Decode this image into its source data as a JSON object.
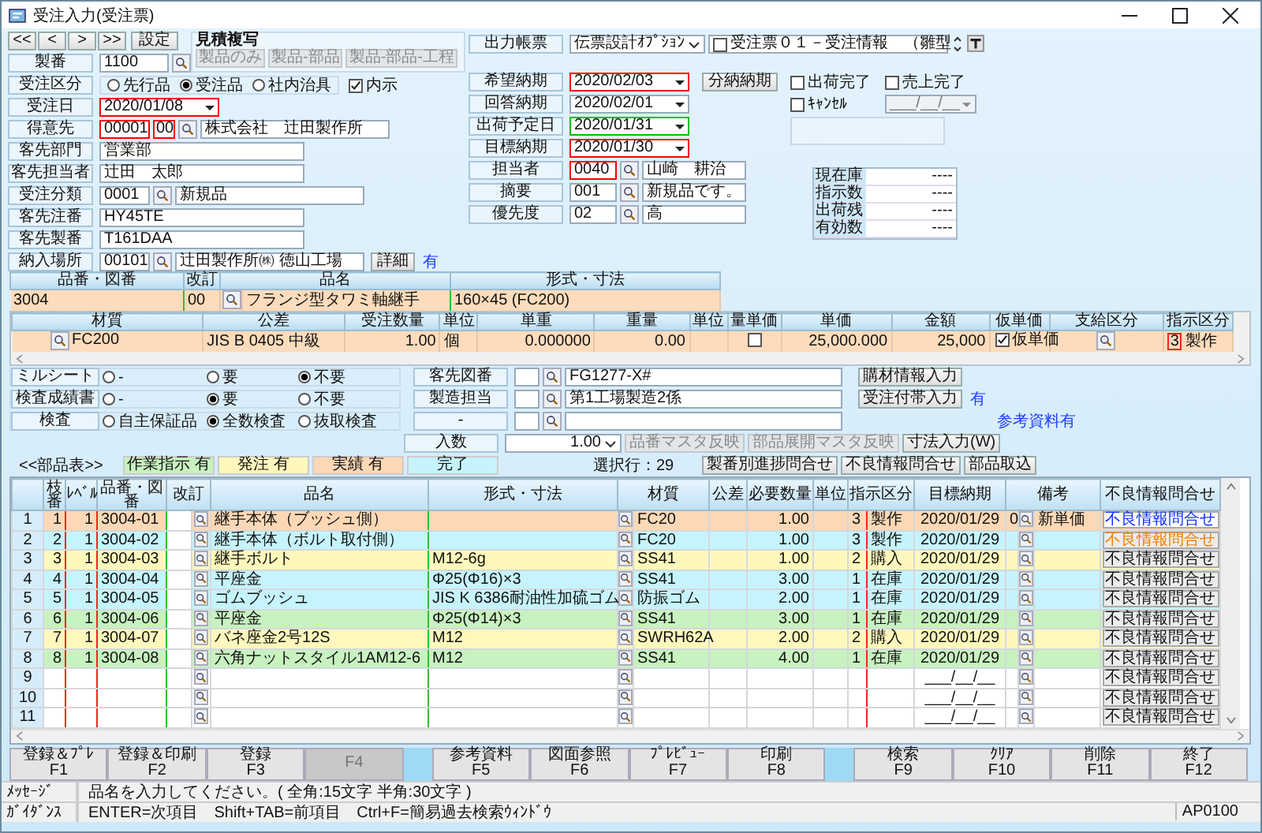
{
  "window": {
    "title": "受注入力(受注票)"
  },
  "nav_buttons": [
    "<<",
    "<",
    ">",
    ">>"
  ],
  "settings_button": "設定",
  "estimate_copy": {
    "title": "見積複写",
    "buttons": [
      {
        "label": "製品のみ",
        "disabled": true
      },
      {
        "label": "製品-部品",
        "disabled": true
      },
      {
        "label": "製品-部品-工程",
        "disabled": true
      }
    ]
  },
  "left_fields": [
    {
      "label": "製番",
      "kind": "lookup",
      "value": "1100"
    },
    {
      "label": "受注区分",
      "kind": "radio",
      "choices": [
        {
          "label": "先行品",
          "selected": false
        },
        {
          "label": "受注品",
          "selected": true
        },
        {
          "label": "社内治具",
          "selected": false
        }
      ],
      "checkbox": {
        "label": "内示",
        "checked": true
      }
    },
    {
      "label": "受注日",
      "kind": "date",
      "value": "2020/01/08",
      "color": "#ff0000"
    },
    {
      "label": "得意先",
      "kind": "code",
      "code": "00001",
      "sub_code": "00",
      "color": "#ff0000",
      "name": "株式会社　辻田製作所"
    },
    {
      "label": "客先部門",
      "kind": "text",
      "value": "営業部"
    },
    {
      "label": "客先担当者",
      "kind": "text",
      "value": "辻田　太郎"
    },
    {
      "label": "受注分類",
      "kind": "code",
      "code": "0001",
      "name": "新規品"
    },
    {
      "label": "客先注番",
      "kind": "text",
      "value": "HY45TE"
    },
    {
      "label": "客先製番",
      "kind": "text",
      "value": "T161DAA"
    },
    {
      "label": "納入場所",
      "kind": "code",
      "code": "00101",
      "name": "辻田製作所㈱ 徳山工場",
      "button": "詳細",
      "note": "有"
    }
  ],
  "output": {
    "label": "出力帳票",
    "value": "伝票設計ｵﾌﾟｼｮﾝ",
    "form": {
      "label": "受注票０１－受注情報　（雛型",
      "checked": false
    }
  },
  "mid_fields": [
    {
      "label": "希望納期",
      "kind": "date",
      "value": "2020/02/03",
      "color": "#ff0000",
      "button": "分納納期"
    },
    {
      "label": "回答納期",
      "kind": "date",
      "value": "2020/02/01"
    },
    {
      "label": "出荷予定日",
      "kind": "date",
      "value": "2020/01/31",
      "color": "#00c000"
    },
    {
      "label": "目標納期",
      "kind": "date",
      "value": "2020/01/30",
      "color": "#ff0000"
    },
    {
      "label": "担当者",
      "kind": "code",
      "code": "0040",
      "color": "#ff0000",
      "name": "山崎　耕治"
    },
    {
      "label": "摘要",
      "kind": "code",
      "code": "001",
      "name": "新規品です。"
    },
    {
      "label": "優先度",
      "kind": "code",
      "code": "02",
      "name": "高"
    }
  ],
  "status_checks": [
    {
      "label": "出荷完了",
      "checked": false
    },
    {
      "label": "売上完了",
      "checked": false
    },
    {
      "label": "ｷｬﾝｾﾙ",
      "checked": false
    }
  ],
  "cancel_date": "___/__/__",
  "stock": [
    {
      "label": "現在庫",
      "value": "----"
    },
    {
      "label": "指示数",
      "value": "----"
    },
    {
      "label": "出荷残",
      "value": "----"
    },
    {
      "label": "有効数",
      "value": "----"
    }
  ],
  "product": {
    "columns": [
      "品番・図番",
      "改訂",
      "品名",
      "形式・寸法"
    ],
    "part_no": "3004",
    "rev": "00",
    "name": "フランジ型タワミ軸継手",
    "spec": "160×45 (FC200)"
  },
  "order": {
    "columns": [
      "材質",
      "公差",
      "受注数量",
      "単位",
      "単重",
      "重量",
      "単位",
      "量単価",
      "単価",
      "金額",
      "仮単価",
      "支給区分",
      "指示区分"
    ],
    "material": "FC200",
    "tolerance": "JIS B 0405 中級",
    "qty": "1.00",
    "unit": "個",
    "unit_weight": "0.000000",
    "weight": "0.00",
    "qty_price_checked": false,
    "price": "25,000.000",
    "amount": "25,000",
    "provisional": {
      "label": "仮単価",
      "checked": true
    },
    "instr_code": "3",
    "instr_label": "製作"
  },
  "options": [
    {
      "label": "ミルシート",
      "choices": [
        {
          "label": "-",
          "selected": false
        },
        {
          "label": "要",
          "selected": false
        },
        {
          "label": "不要",
          "selected": true
        }
      ]
    },
    {
      "label": "検査成績書",
      "choices": [
        {
          "label": "-",
          "selected": false
        },
        {
          "label": "要",
          "selected": true
        },
        {
          "label": "不要",
          "selected": false
        }
      ]
    },
    {
      "label": "検査",
      "choices": [
        {
          "label": "自主保証品",
          "selected": false
        },
        {
          "label": "全数検査",
          "selected": true
        },
        {
          "label": "抜取検査",
          "selected": false
        }
      ]
    }
  ],
  "customer_fields": [
    {
      "label": "客先図番",
      "value": "FG1277-X#"
    },
    {
      "label": "製造担当",
      "value": "第1工場製造2係"
    },
    {
      "label": "-"
    }
  ],
  "side_buttons": [
    {
      "label": "購材情報入力"
    },
    {
      "label": "受注付帯入力",
      "note": "有"
    }
  ],
  "reference_link": "参考資料有",
  "quantity": {
    "label": "入数",
    "value": "1.00"
  },
  "mid_buttons": [
    {
      "label": "品番マスタ反映",
      "disabled": true
    },
    {
      "label": "部品展開マスタ反映",
      "disabled": true
    },
    {
      "label": "寸法入力(W)",
      "disabled": false
    }
  ],
  "legend": {
    "title": "<<部品表>>",
    "items": [
      {
        "label": "作業指示 有",
        "color": "#c8f2c0"
      },
      {
        "label": "発注 有",
        "color": "#fff8bc"
      },
      {
        "label": "実績 有",
        "color": "#fcd8b6"
      },
      {
        "label": "完了",
        "color": "#c6f4fc"
      }
    ]
  },
  "selected_rows": "選択行：29",
  "bom_buttons": [
    "製番別進捗問合せ",
    "不良情報問合せ",
    "部品取込"
  ],
  "grid": {
    "columns": [
      "枝番",
      "ﾚﾍﾞﾙ",
      "品番・図番",
      "改訂",
      "品名",
      "形式・寸法",
      "材質",
      "公差",
      "必要数量",
      "単位",
      "指示区分",
      "目標納期",
      "備考",
      "不良情報問合せ"
    ],
    "rows": [
      {
        "no": "1",
        "branch": "1",
        "level": "1",
        "part_no": "3004-01",
        "name": "継手本体（ブッシュ側）",
        "material": "FC20",
        "qty": "1.00",
        "instr_code": "3",
        "instr_label": "製作",
        "due": "2020/01/29",
        "remark_no": "0",
        "remark": "新単価",
        "inquiry": {
          "label": "不良情報問合せ",
          "kind": "link"
        },
        "color": "#fcd8b6"
      },
      {
        "no": "2",
        "branch": "2",
        "level": "1",
        "part_no": "3004-02",
        "name": "継手本体（ボルト取付側）",
        "material": "FC20",
        "qty": "1.00",
        "instr_code": "3",
        "instr_label": "製作",
        "due": "2020/01/29",
        "inquiry": {
          "label": "不良情報問合せ",
          "kind": "warning"
        },
        "color": "#c6f4fc"
      },
      {
        "no": "3",
        "branch": "3",
        "level": "1",
        "part_no": "3004-03",
        "name": "継手ボルト",
        "spec": "M12-6g",
        "material": "SS41",
        "qty": "1.00",
        "instr_code": "2",
        "instr_label": "購入",
        "due": "2020/01/29",
        "inquiry": {
          "label": "不良情報問合せ",
          "kind": "normal"
        },
        "color": "#fff8bc"
      },
      {
        "no": "4",
        "branch": "4",
        "level": "1",
        "part_no": "3004-04",
        "name": "平座金",
        "spec": "Φ25(Φ16)×3",
        "material": "SS41",
        "qty": "3.00",
        "instr_code": "1",
        "instr_label": "在庫",
        "due": "2020/01/29",
        "inquiry": {
          "label": "不良情報問合せ",
          "kind": "normal"
        },
        "color": "#c6f4fc"
      },
      {
        "no": "5",
        "branch": "5",
        "level": "1",
        "part_no": "3004-05",
        "name": "ゴムブッシュ",
        "spec": "JIS K 6386耐油性加硫ゴム",
        "material": "防振ゴム",
        "qty": "2.00",
        "instr_code": "1",
        "instr_label": "在庫",
        "due": "2020/01/29",
        "inquiry": {
          "label": "不良情報問合せ",
          "kind": "normal"
        },
        "color": "#c6f4fc"
      },
      {
        "no": "6",
        "branch": "6",
        "level": "1",
        "part_no": "3004-06",
        "name": "平座金",
        "spec": "Φ25(Φ14)×3",
        "material": "SS41",
        "qty": "3.00",
        "instr_code": "1",
        "instr_label": "在庫",
        "due": "2020/01/29",
        "inquiry": {
          "label": "不良情報問合せ",
          "kind": "normal"
        },
        "color": "#c8f2c0"
      },
      {
        "no": "7",
        "branch": "7",
        "level": "1",
        "part_no": "3004-07",
        "name": "バネ座金2号12S",
        "spec": "M12",
        "material": "SWRH62A",
        "qty": "2.00",
        "instr_code": "2",
        "instr_label": "購入",
        "due": "2020/01/29",
        "inquiry": {
          "label": "不良情報問合せ",
          "kind": "normal"
        },
        "color": "#fff8bc"
      },
      {
        "no": "8",
        "branch": "8",
        "level": "1",
        "part_no": "3004-08",
        "name": "六角ナットスタイル1AM12-6",
        "spec": "M12",
        "material": "SS41",
        "qty": "4.00",
        "instr_code": "1",
        "instr_label": "在庫",
        "due": "2020/01/29",
        "inquiry": {
          "label": "不良情報問合せ",
          "kind": "normal"
        },
        "color": "#c8f2c0"
      },
      {
        "no": "9",
        "due": "___/__/__",
        "inquiry": {
          "label": "不良情報問合せ",
          "kind": "normal"
        },
        "color": "#ffffff"
      },
      {
        "no": "10",
        "due": "___/__/__",
        "inquiry": {
          "label": "不良情報問合せ",
          "kind": "normal"
        },
        "color": "#ffffff"
      },
      {
        "no": "11",
        "due": "___/__/__",
        "inquiry": {
          "label": "不良情報問合せ",
          "kind": "normal"
        },
        "color": "#ffffff"
      }
    ]
  },
  "function_keys": [
    [
      {
        "label": "登録＆ﾌﾟﾚ",
        "key": "F1",
        "disabled": false
      },
      {
        "label": "登録＆印刷",
        "key": "F2",
        "disabled": false
      },
      {
        "label": "登録",
        "key": "F3",
        "disabled": false
      },
      {
        "key": "F4",
        "disabled": true
      }
    ],
    [
      {
        "label": "参考資料",
        "key": "F5",
        "disabled": false
      },
      {
        "label": "図面参照",
        "key": "F6",
        "disabled": false
      },
      {
        "label": "ﾌﾟﾚﾋﾞｭｰ",
        "key": "F7",
        "disabled": false
      },
      {
        "label": "印刷",
        "key": "F8",
        "disabled": false
      }
    ],
    [
      {
        "label": "検索",
        "key": "F9",
        "disabled": false
      },
      {
        "label": "ｸﾘｱ",
        "key": "F10",
        "disabled": false
      },
      {
        "label": "削除",
        "key": "F11",
        "disabled": false
      },
      {
        "label": "終了",
        "key": "F12",
        "disabled": false
      }
    ]
  ],
  "message": {
    "label": "ﾒｯｾｰｼﾞ",
    "text": "品名を入力してください。( 全角:15文字 半角:30文字 )"
  },
  "guidance": {
    "label": "ｶﾞｲﾀﾞﾝｽ",
    "text": "ENTER=次項目　Shift+TAB=前項目　Ctrl+F=簡易過去検索ｳｨﾝﾄﾞｳ",
    "code": "AP0100"
  }
}
